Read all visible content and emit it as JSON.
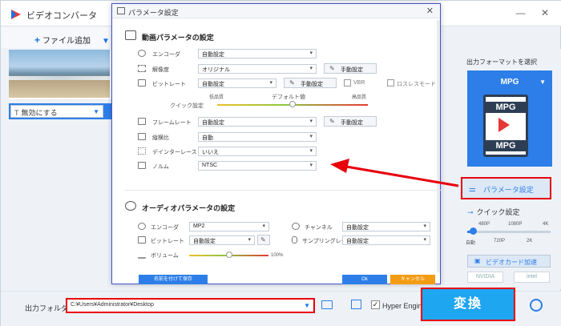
{
  "app": {
    "title": "ビデオコンバータ"
  },
  "toolbar": {
    "add_file_label": "ファイル追加"
  },
  "file": {
    "subtitle_select": "無効にする"
  },
  "dialog": {
    "title": "パラメータ設定",
    "video_section": "動画パラメータの設定",
    "video": {
      "encoder_label": "エンコーダ",
      "encoder_value": "自動設定",
      "resolution_label": "解像度",
      "resolution_value": "オリジナル",
      "bitrate_label": "ビットレート",
      "bitrate_value": "自動設定",
      "vbr_label": "VBR",
      "lossless_label": "ロスレスモード",
      "quick_label": "クイック設定",
      "quality_low": "低品質",
      "quality_default": "デフォルト値",
      "quality_high": "高品質",
      "quick_position": 0.5,
      "framerate_label": "フレームレート",
      "framerate_value": "自動設定",
      "aspect_label": "縦横比",
      "aspect_value": "自動",
      "deinterlace_label": "デインターレース",
      "deinterlace_value": "いいえ",
      "norm_label": "ノルム",
      "norm_value": "NTSC"
    },
    "manual_label": "手動設定",
    "audio_section": "オーディオパラメータの設定",
    "audio": {
      "encoder_label": "エンコーダ",
      "encoder_value": "MP2",
      "channel_label": "チャンネル",
      "channel_value": "自動設定",
      "bitrate_label": "ビットレート",
      "bitrate_value": "自動設定",
      "samplerate_label": "サンプリングレート",
      "samplerate_value": "自動設定",
      "volume_label": "ボリューム",
      "volume_value": "100%",
      "volume_position": 0.5
    },
    "save_as_label": "名前を付けて保存",
    "ok_label": "Ok",
    "cancel_label": "キャンセル"
  },
  "right": {
    "output_format_label": "出力フォーマットを選択",
    "format_name": "MPG",
    "format_icon_top": "MPG",
    "format_icon_bottom": "MPG",
    "param_button": "パラメータ設定",
    "quick_settings": "クイック設定",
    "quick_top": [
      "480P",
      "1080P",
      "4K"
    ],
    "quick_bottom": [
      "自動",
      "720P",
      "2K"
    ],
    "quick_level": 0,
    "video_card_button": "ビデオカード加速",
    "gpu": [
      "NVIDIA",
      "intel"
    ]
  },
  "bottom": {
    "output_folder_label": "出力フォルダ：",
    "output_folder_value": "C:¥Users¥Administrator¥Desktop",
    "hyper_engine_label": "Hyper Engine",
    "hyper_engine_checked": true,
    "convert_label": "変換"
  },
  "colors": {
    "accent": "#2d7ee8",
    "highlight": "#e8000c",
    "convert": "#1fa6f0",
    "cancel": "#f39c12"
  }
}
